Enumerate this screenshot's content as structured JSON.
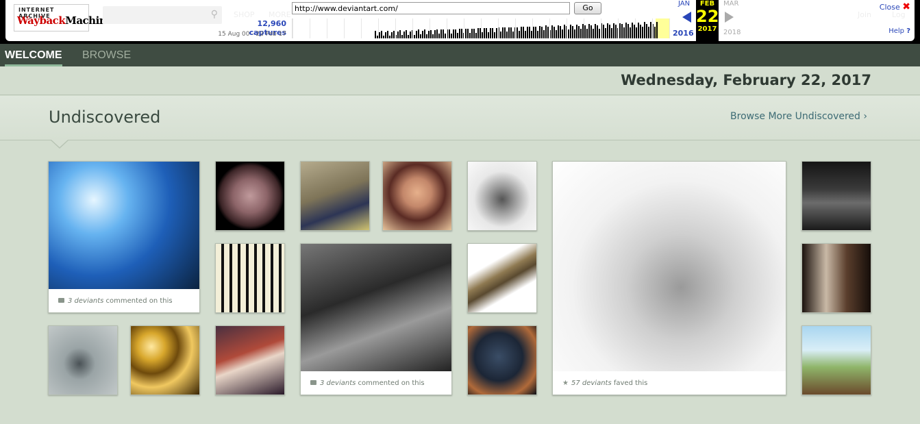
{
  "wayback": {
    "logo_top": "INTERNET ARCHIVE",
    "logo_main_1": "Wayback",
    "logo_main_2": "Machine",
    "url": "http://www.deviantart.com/",
    "go_label": "Go",
    "captures": "12,960 captures",
    "range": "15 Aug 00 - 22 Feb 17",
    "prev_month": "JAN",
    "cur_month": "FEB",
    "cur_day": "22",
    "cur_year": "2017",
    "next_month": "MAR",
    "prev_year": "2016",
    "next_year": "2018",
    "close_label": "Close",
    "help_label": "Help",
    "ghost_links": [
      "SHOP",
      "MORE",
      "Join",
      "Log"
    ]
  },
  "nav": {
    "tabs": [
      {
        "label": "WELCOME",
        "active": true
      },
      {
        "label": "BROWSE",
        "active": false
      }
    ]
  },
  "date": "Wednesday, February 22, 2017",
  "section": {
    "title": "Undiscovered",
    "browse_more": "Browse More Undiscovered"
  },
  "captions": {
    "c1": {
      "count": "3 deviants",
      "action": "commented on this"
    },
    "c2": {
      "count": "3 deviants",
      "action": "commented on this"
    },
    "c3": {
      "count": "57 deviants",
      "action": "faved this"
    }
  }
}
